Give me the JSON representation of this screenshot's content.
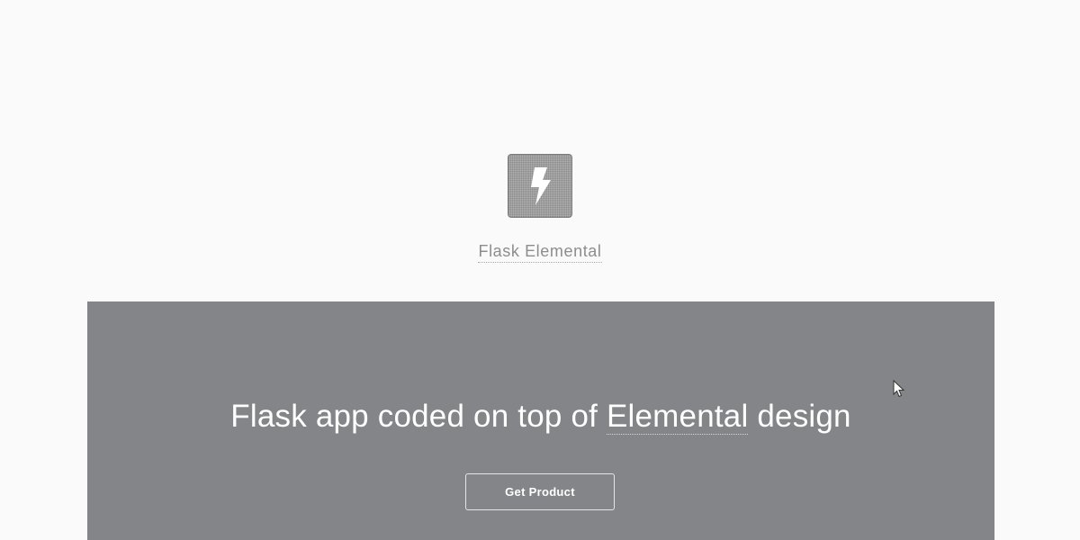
{
  "brand": {
    "logo_icon": "lightning-bolt-icon",
    "name": "Flask Elemental"
  },
  "hero": {
    "title_prefix": "Flask app coded on top of ",
    "title_link": "Elemental",
    "title_suffix": " design",
    "cta_label": "Get Product"
  },
  "colors": {
    "page_background": "#fafafa",
    "hero_background": "#838588",
    "logo_background": "#8a8a8a",
    "brand_text": "#8d8d8d",
    "hero_text": "#ffffff"
  }
}
